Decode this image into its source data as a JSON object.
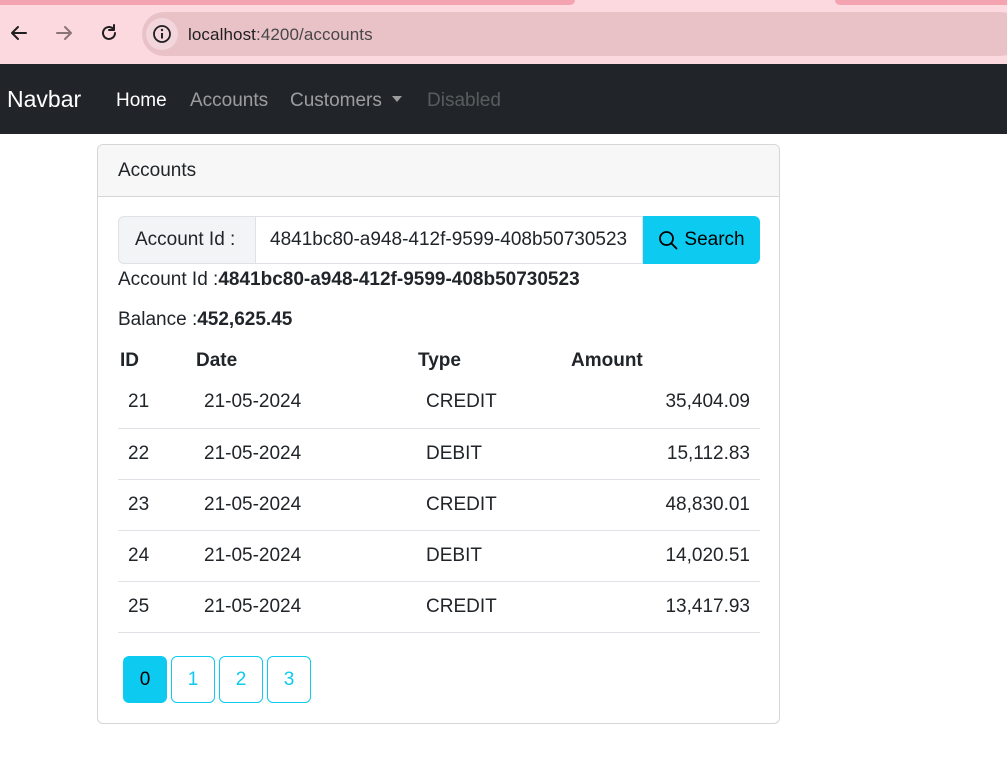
{
  "browser": {
    "url_host": "localhost",
    "url_path": ":4200/accounts"
  },
  "navbar": {
    "brand": "Navbar",
    "links": [
      {
        "label": "Home"
      },
      {
        "label": "Accounts"
      },
      {
        "label": "Customers"
      },
      {
        "label": "Disabled"
      }
    ]
  },
  "card": {
    "header": "Accounts",
    "search": {
      "label": "Account Id :",
      "value": "4841bc80-a948-412f-9599-408b50730523",
      "button": "Search"
    },
    "account_id_label": "Account Id :",
    "account_id_value": "4841bc80-a948-412f-9599-408b50730523",
    "balance_label": "Balance :",
    "balance_value": "452,625.45",
    "table": {
      "headers": [
        "ID",
        "Date",
        "Type",
        "Amount"
      ],
      "rows": [
        [
          "21",
          "21-05-2024",
          "CREDIT",
          "35,404.09"
        ],
        [
          "22",
          "21-05-2024",
          "DEBIT",
          "15,112.83"
        ],
        [
          "23",
          "21-05-2024",
          "CREDIT",
          "48,830.01"
        ],
        [
          "24",
          "21-05-2024",
          "DEBIT",
          "14,020.51"
        ],
        [
          "25",
          "21-05-2024",
          "CREDIT",
          "13,417.93"
        ]
      ]
    },
    "pages": [
      "0",
      "1",
      "2",
      "3"
    ],
    "active_page": "0"
  },
  "colors": {
    "accent": "#0dcaf0",
    "navbar_bg": "#212529",
    "chrome_bg": "#fbd9df"
  }
}
